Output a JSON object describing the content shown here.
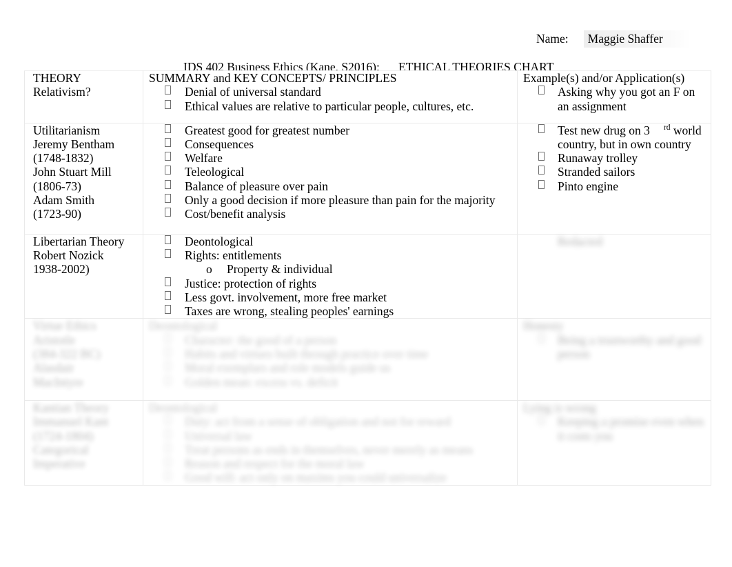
{
  "header": {
    "name_label": "Name:",
    "name_value": "Maggie Shaffer"
  },
  "title": {
    "course": "IDS 402 Business Ethics (Kane, S2016):",
    "chart": "ETHICAL THEORIES CHART"
  },
  "columns": {
    "theory": "THEORY",
    "summary": "SUMMARY and KEY CONCEPTS/ PRINCIPLES",
    "example": "Example(s) and/or Application(s)"
  },
  "rows": [
    {
      "theory": "Relativism?",
      "theory_lines": [
        "Relativism?"
      ],
      "summary": [
        "Denial of universal standard",
        "Ethical values are relative to particular people, cultures, etc."
      ],
      "examples": [
        "Asking why you got an F on an assignment"
      ],
      "redacted": false
    },
    {
      "theory": "Utilitarianism",
      "theory_lines": [
        "Utilitarianism",
        "Jeremy Bentham",
        "(1748-1832)",
        "John Stuart Mill",
        "(1806-73)",
        "Adam Smith",
        "(1723-90)"
      ],
      "summary": [
        "Greatest good for greatest number",
        "Consequences",
        "Welfare",
        "Teleological",
        "Balance of pleasure over pain",
        "Only a good decision if more pleasure than pain for the majority",
        "Cost/benefit analysis"
      ],
      "examples": [
        "Test new drug on 3rd world country, but in own country",
        "Runaway trolley",
        "Stranded sailors",
        "Pinto engine"
      ],
      "example_first_parts": {
        "lead": "Test new drug on 3",
        "sup": "rd",
        "tail": "world",
        "rest": "country, but in own country"
      },
      "redacted": false
    },
    {
      "theory": "Libertarian Theory",
      "theory_lines": [
        "Libertarian Theory",
        "Robert Nozick",
        "1938-2002)"
      ],
      "summary": [
        "Deontological",
        "Rights: entitlements",
        "Justice: protection of rights",
        "Less govt. involvement, more free market",
        "Taxes are wrong, stealing peoples' earnings"
      ],
      "summary_sub": {
        "after": "Rights: entitlements",
        "marker": "o",
        "text": "Property & individual"
      },
      "examples": [],
      "example_redacted_text": "Redacted",
      "redacted_example": true,
      "redacted": false
    },
    {
      "theory_lines": [
        "",
        "",
        "",
        "",
        ""
      ],
      "summary": [
        "",
        "",
        "",
        "",
        ""
      ],
      "examples": [
        "",
        "",
        ""
      ],
      "redacted": true,
      "note": "row content blurred beyond legibility in source image"
    },
    {
      "theory_lines": [
        "",
        "",
        "",
        "",
        "",
        ""
      ],
      "summary": [
        "",
        "",
        "",
        "",
        "",
        ""
      ],
      "examples": [
        "",
        "",
        ""
      ],
      "redacted": true,
      "note": "row content blurred beyond legibility in source image"
    }
  ]
}
